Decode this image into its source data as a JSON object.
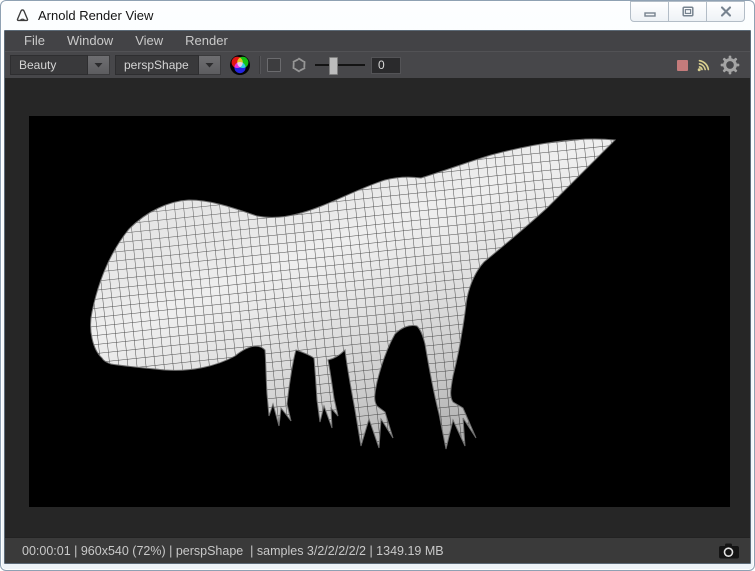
{
  "window": {
    "title": "Arnold Render View",
    "controls": {
      "minimize": "minimize",
      "maximize": "maximize",
      "close": "close"
    }
  },
  "menu_bar": {
    "items": [
      {
        "label": "File"
      },
      {
        "label": "Window"
      },
      {
        "label": "View"
      },
      {
        "label": "Render"
      }
    ]
  },
  "toolbar": {
    "aov_dropdown": {
      "value": "Beauty"
    },
    "camera_dropdown": {
      "value": "perspShape"
    },
    "display_checkbox": {
      "checked": false
    },
    "exposure_field": {
      "value": "0"
    },
    "icons": {
      "color_wheel": "rgb-color-wheel-icon",
      "aperture": "exposure-aperture-icon",
      "stop": "abort-render-icon",
      "live": "live-updates-icon",
      "gear": "settings-gear-icon"
    },
    "colors": {
      "stop_red": "#c47b7b",
      "live_yellow": "#d9cf8f",
      "icon_gray": "#9a9a9a"
    }
  },
  "render_view": {
    "canvas_background": "#000000",
    "subject": "wireframe t-rex model"
  },
  "status_bar": {
    "text": "00:00:01 | 960x540 (72%) | perspShape  | samples 3/2/2/2/2/2 | 1349.19 MB",
    "camera_icon": "snapshot-camera-icon"
  }
}
